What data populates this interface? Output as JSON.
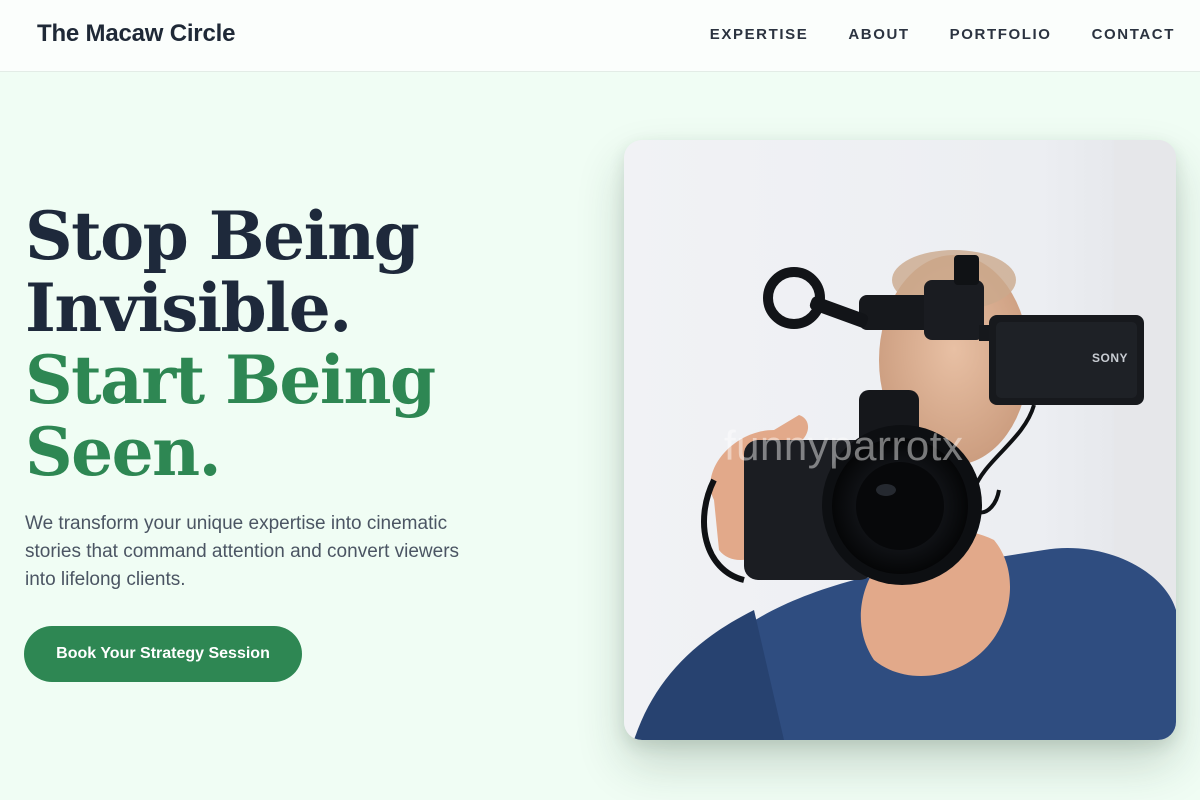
{
  "header": {
    "brand": "The Macaw Circle",
    "nav": [
      "EXPERTISE",
      "ABOUT",
      "PORTFOLIO",
      "CONTACT"
    ]
  },
  "hero": {
    "headline_line1": "Stop Being",
    "headline_line2": "Invisible.",
    "headline_line3": "Start Being",
    "headline_line4": "Seen.",
    "subtext": "We transform your unique expertise into cinematic stories that command attention and convert viewers into lifelong clients.",
    "cta_label": "Book Your Strategy Session"
  },
  "photo": {
    "camera_brand": "SONY",
    "watermark": "funnyparrotx"
  },
  "colors": {
    "page_background": "#f0fdf4",
    "brand_green": "#2e8753",
    "headline_dark": "#1e293b",
    "body_text": "#4b5563"
  }
}
